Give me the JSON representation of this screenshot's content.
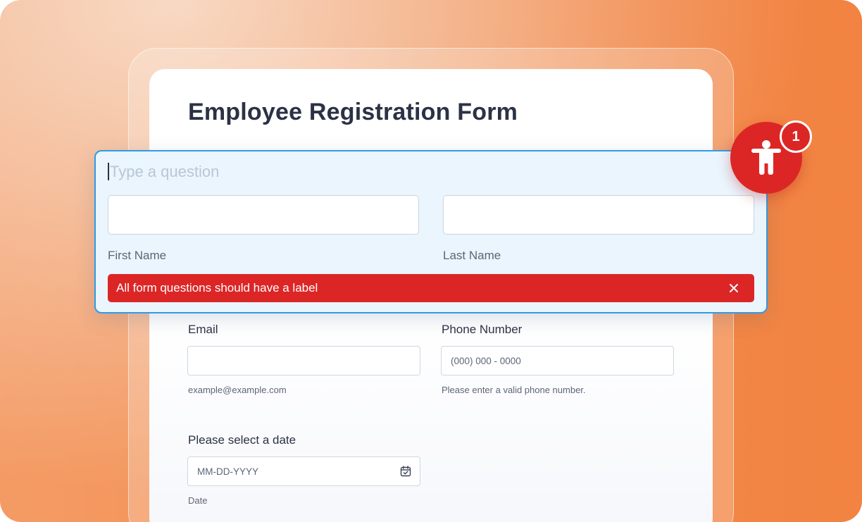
{
  "form": {
    "title": "Employee Registration Form"
  },
  "question_panel": {
    "placeholder": "Type a question",
    "first_name_label": "First Name",
    "last_name_label": "Last Name",
    "alert": {
      "message": "All form questions should have a label",
      "close_icon": "close-icon"
    }
  },
  "accessibility_badge": {
    "icon": "accessibility-person-icon",
    "count": "1"
  },
  "fields": {
    "email": {
      "label": "Email",
      "value": "",
      "hint": "example@example.com"
    },
    "phone": {
      "label": "Phone Number",
      "placeholder": "(000) 000 - 0000",
      "hint": "Please enter a valid phone number."
    },
    "date": {
      "label": "Please select a date",
      "placeholder": "MM-DD-YYYY",
      "hint": "Date",
      "icon": "calendar-check-icon"
    }
  },
  "colors": {
    "accent": "#2f9be6",
    "error": "#dc2626",
    "text": "#2b3245"
  }
}
